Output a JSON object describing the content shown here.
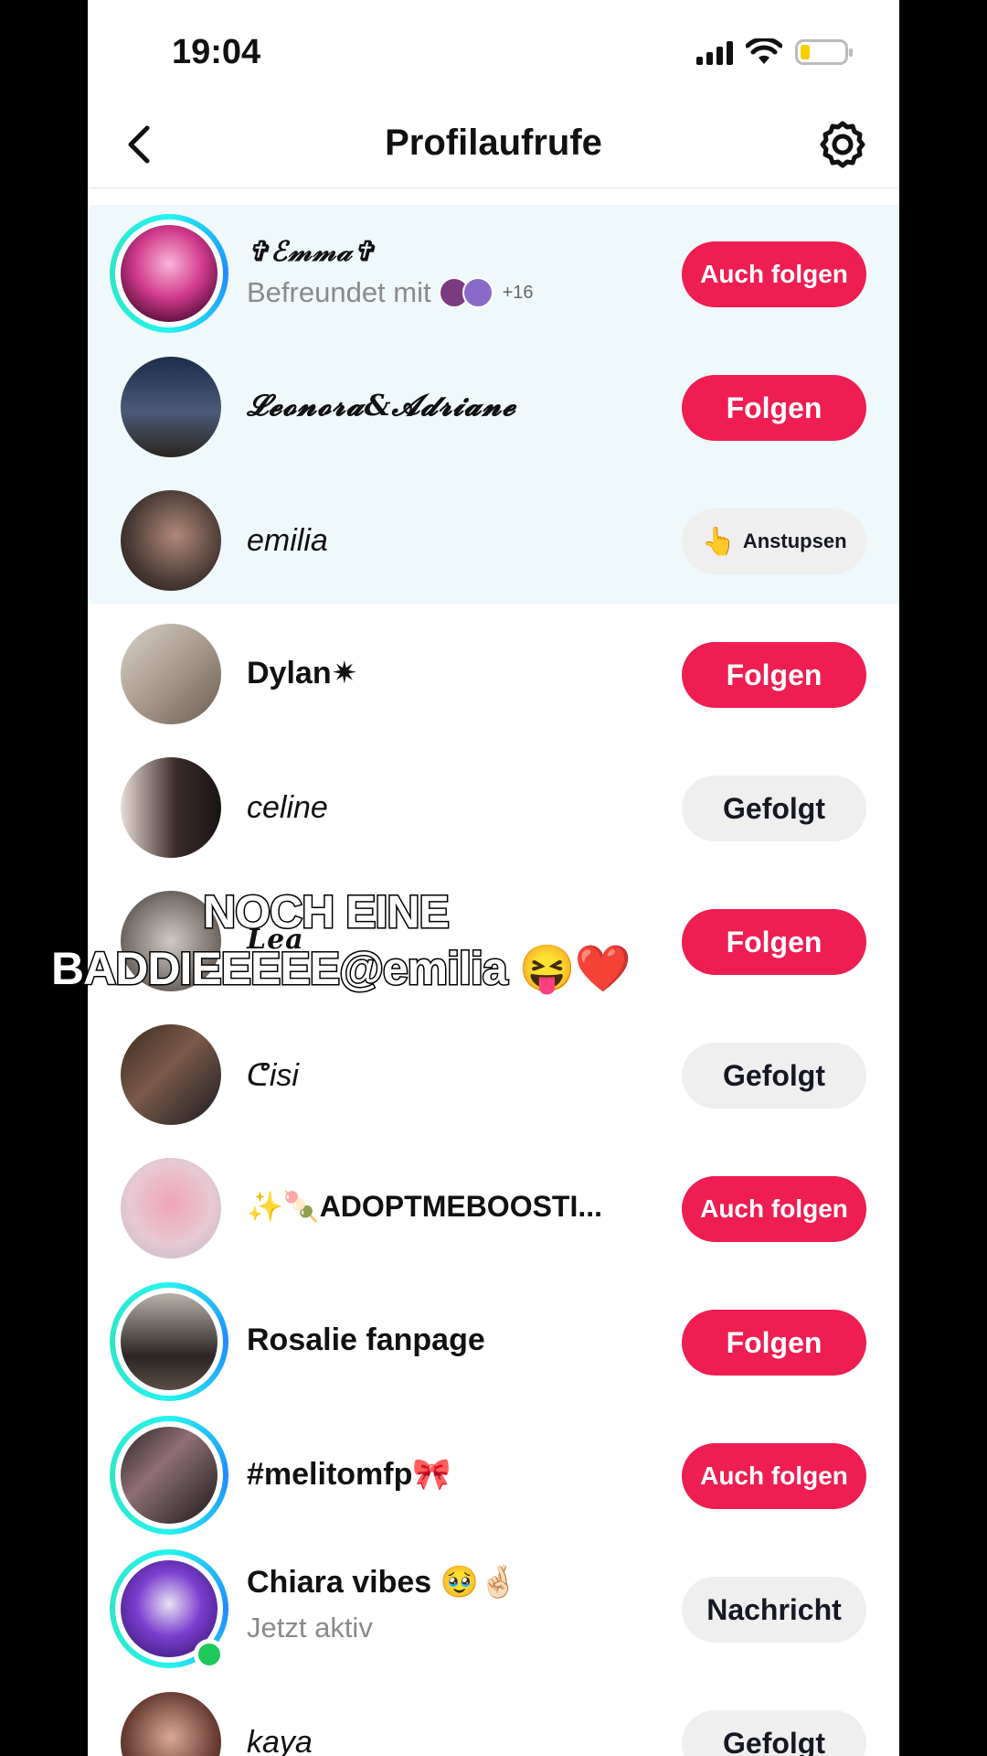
{
  "status_bar": {
    "time": "19:04"
  },
  "header": {
    "title": "Profilaufrufe"
  },
  "rows": [
    {
      "name": "✞ℰ𝓂𝓂𝒶✞",
      "sub": "Befreundet mit",
      "mutual_count": "+16",
      "button": "Auch folgen"
    },
    {
      "name": "𝓛𝓮𝓸𝓷𝓸𝓻𝓪&𝓐𝓭𝓻𝓲𝓪𝓷𝓮",
      "button": "Folgen"
    },
    {
      "name": "emilia",
      "button": "Anstupsen",
      "button_emoji": "👆"
    },
    {
      "name": "Dylan✷",
      "button": "Folgen"
    },
    {
      "name": "celine",
      "button": "Gefolgt"
    },
    {
      "name": "Lea",
      "button": "Folgen"
    },
    {
      "name": "ᕦisi",
      "button": "Gefolgt"
    },
    {
      "name": "✨🍡ADOPTMEBOOSTI...",
      "button": "Auch folgen"
    },
    {
      "name": "Rosalie fanpage",
      "button": "Folgen"
    },
    {
      "name": "#melitomfp🎀",
      "button": "Auch folgen"
    },
    {
      "name": "Chiara vibes 🥹🤞🏻",
      "sub": "Jetzt aktiv",
      "button": "Nachricht"
    },
    {
      "name": "kaya",
      "button": "Gefolgt"
    }
  ],
  "caption": {
    "line1": "NOCH EINE",
    "line2": "BADDIEEEEE@emilia 😝❤️"
  },
  "colors": {
    "accent": "#ee1d52",
    "highlight": "#eff8fb",
    "ring": "#25f4ee",
    "online": "#1ec95a"
  }
}
